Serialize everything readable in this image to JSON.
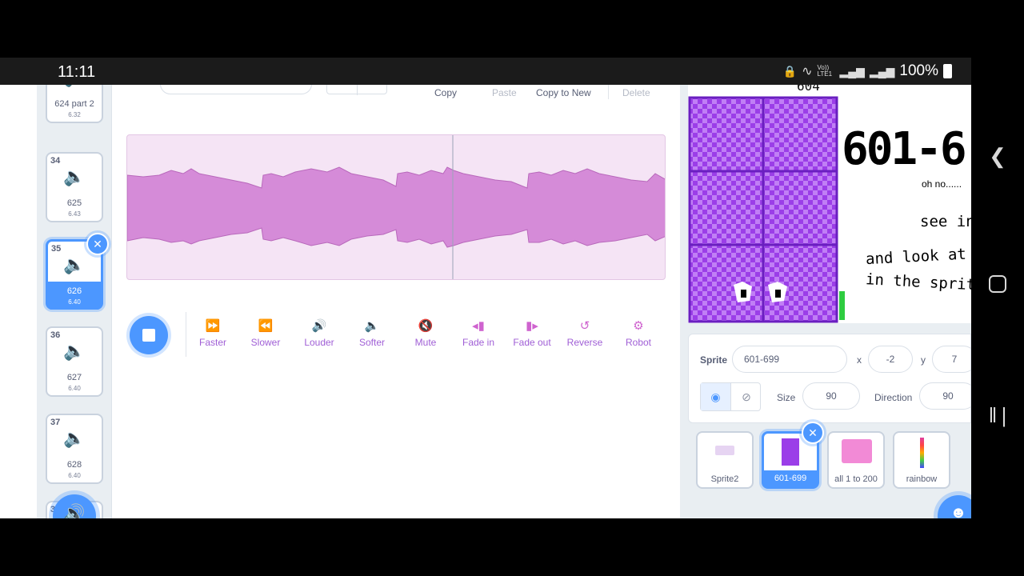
{
  "status_bar": {
    "time": "11:11",
    "network_label": "Vo)) LTE1",
    "battery": "100%"
  },
  "sounds": [
    {
      "number": "",
      "name": "624 part 2",
      "duration": "6.32"
    },
    {
      "number": "34",
      "name": "625",
      "duration": "6.43"
    },
    {
      "number": "35",
      "name": "626",
      "duration": "6.40",
      "selected": true
    },
    {
      "number": "36",
      "name": "627",
      "duration": "6.40"
    },
    {
      "number": "37",
      "name": "628",
      "duration": "6.40"
    },
    {
      "number": "3",
      "name": "",
      "duration": ""
    }
  ],
  "toolbar": {
    "copy": "Copy",
    "paste": "Paste",
    "copy_to_new": "Copy to New",
    "delete": "Delete"
  },
  "effects": [
    {
      "label": "Faster",
      "icon": "faster-icon"
    },
    {
      "label": "Slower",
      "icon": "slower-icon"
    },
    {
      "label": "Louder",
      "icon": "louder-icon"
    },
    {
      "label": "Softer",
      "icon": "softer-icon"
    },
    {
      "label": "Mute",
      "icon": "mute-icon"
    },
    {
      "label": "Fade in",
      "icon": "fade-in-icon"
    },
    {
      "label": "Fade out",
      "icon": "fade-out-icon"
    },
    {
      "label": "Reverse",
      "icon": "reverse-icon"
    },
    {
      "label": "Robot",
      "icon": "robot-icon"
    }
  ],
  "stage": {
    "top_label": "604",
    "title": "601-6",
    "line1": "oh no......",
    "line2": "see in:",
    "line3": "and look at th",
    "line4": "in the sprite"
  },
  "sprite_info": {
    "sprite_label": "Sprite",
    "sprite_name": "601-699",
    "x_label": "x",
    "x_value": "-2",
    "y_label": "y",
    "y_value": "7",
    "size_label": "Size",
    "size_value": "90",
    "direction_label": "Direction",
    "direction_value": "90"
  },
  "sprites": [
    {
      "name": "Sprite2"
    },
    {
      "name": "601-699",
      "selected": true
    },
    {
      "name": "all 1 to 200"
    },
    {
      "name": "rainbow"
    }
  ],
  "colors": {
    "accent": "#4c97ff",
    "sound_wave": "#d58bd8",
    "sound_bg": "#f5e4f5",
    "effect_purple": "#cf63cf",
    "stage_purple": "#9b3ee8"
  }
}
